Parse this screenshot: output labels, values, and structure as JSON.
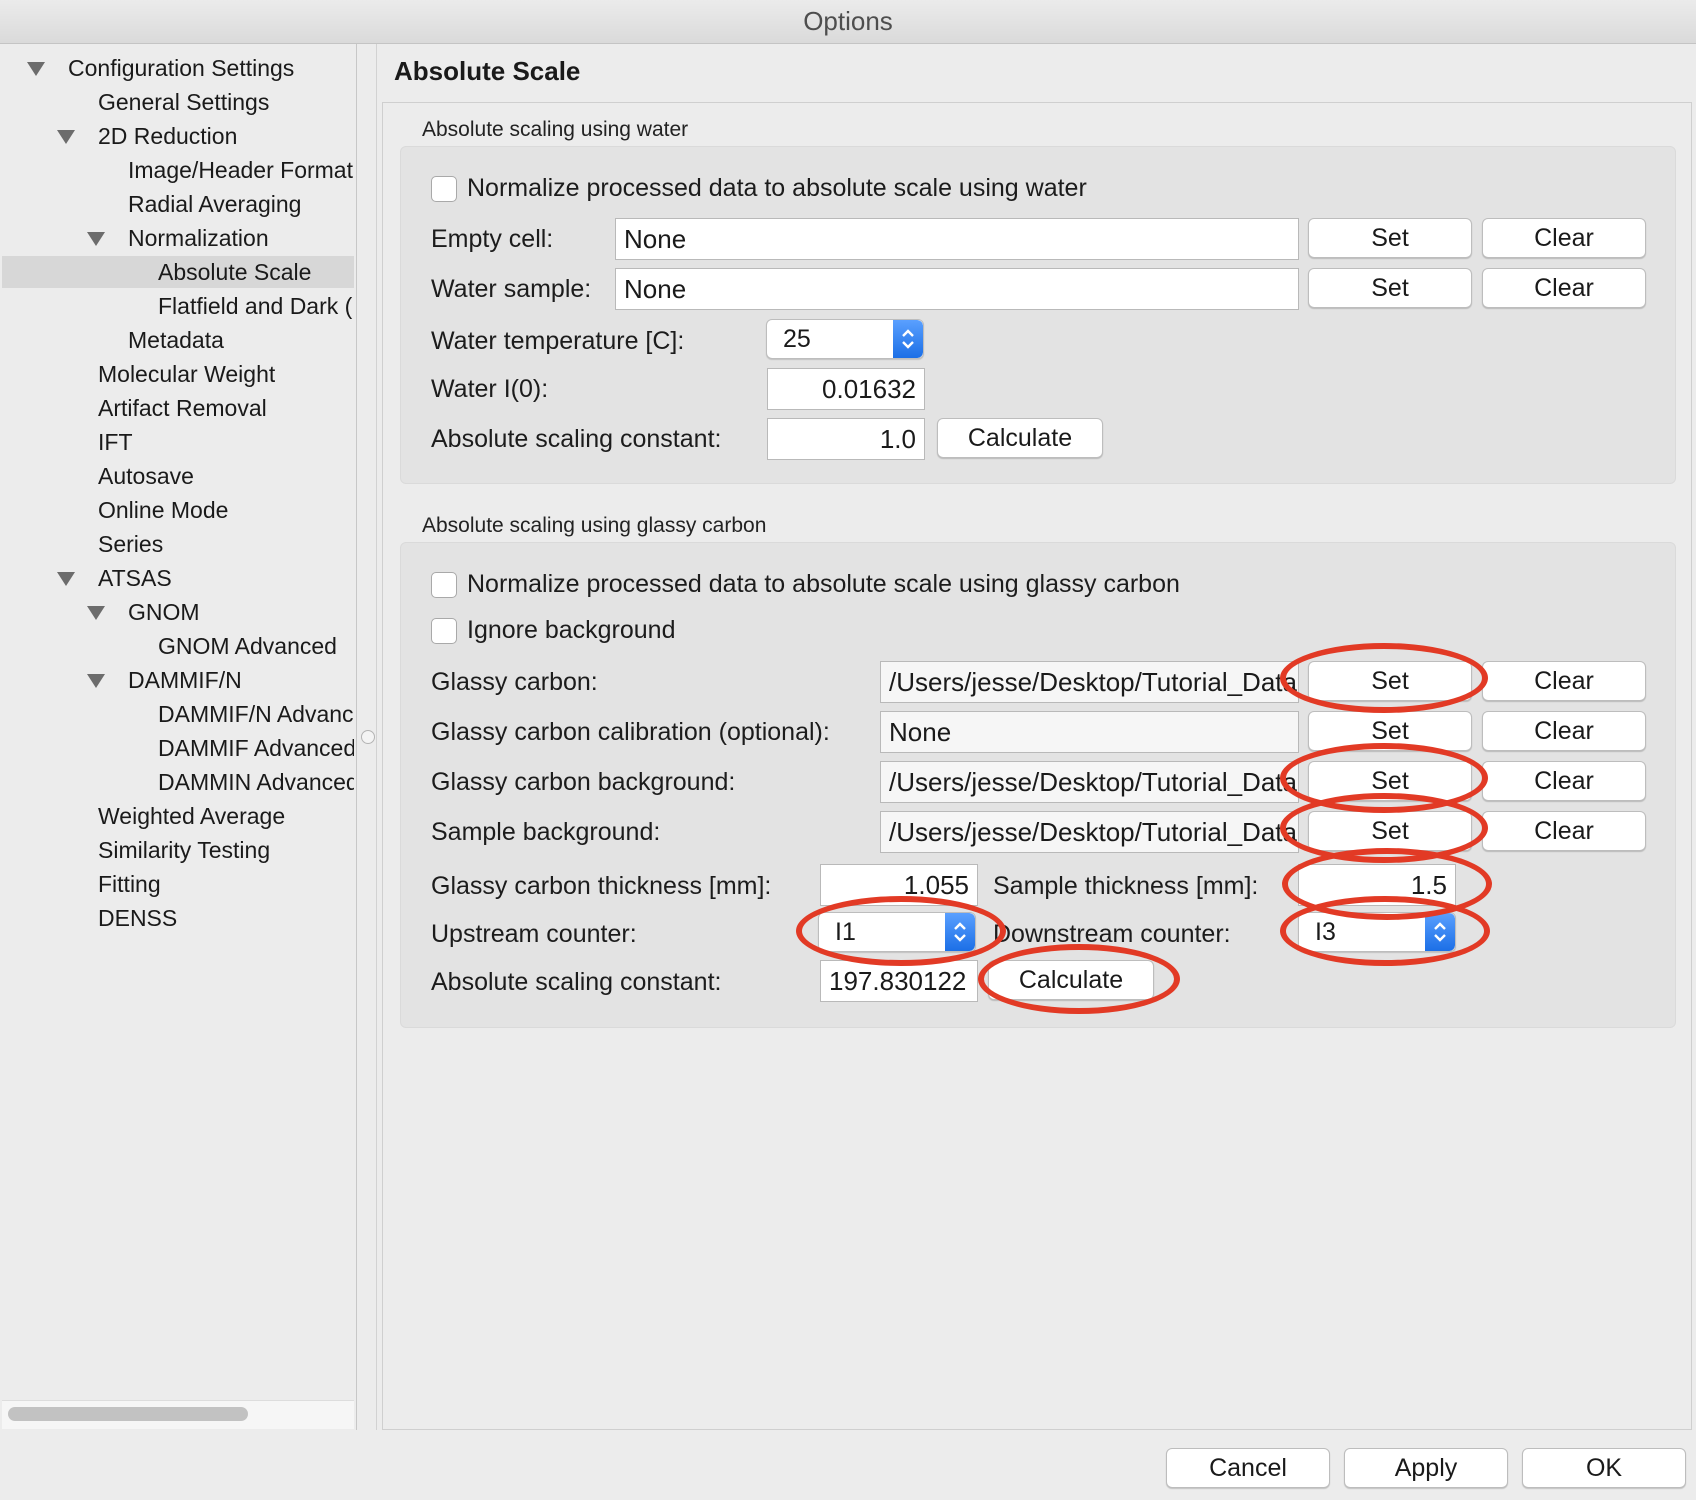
{
  "window": {
    "title": "Options"
  },
  "sidebar": {
    "items": [
      {
        "label": "Configuration Settings",
        "expanded": true
      },
      {
        "label": "General Settings"
      },
      {
        "label": "2D Reduction",
        "expanded": true
      },
      {
        "label": "Image/Header Format"
      },
      {
        "label": "Radial Averaging"
      },
      {
        "label": "Normalization",
        "expanded": true
      },
      {
        "label": "Absolute Scale",
        "selected": true
      },
      {
        "label": "Flatfield and Dark ("
      },
      {
        "label": "Metadata"
      },
      {
        "label": "Molecular Weight"
      },
      {
        "label": "Artifact Removal"
      },
      {
        "label": "IFT"
      },
      {
        "label": "Autosave"
      },
      {
        "label": "Online Mode"
      },
      {
        "label": "Series"
      },
      {
        "label": "ATSAS",
        "expanded": true
      },
      {
        "label": "GNOM",
        "expanded": true
      },
      {
        "label": "GNOM Advanced"
      },
      {
        "label": "DAMMIF/N",
        "expanded": true
      },
      {
        "label": "DAMMIF/N Advance"
      },
      {
        "label": "DAMMIF Advanced"
      },
      {
        "label": "DAMMIN Advanced"
      },
      {
        "label": "Weighted Average"
      },
      {
        "label": "Similarity Testing"
      },
      {
        "label": "Fitting"
      },
      {
        "label": "DENSS"
      }
    ]
  },
  "page": {
    "title": "Absolute Scale"
  },
  "water": {
    "group_title": "Absolute scaling using water",
    "normalize_label": "Normalize processed data to absolute scale using water",
    "normalize_checked": false,
    "empty_cell_label": "Empty cell:",
    "empty_cell_value": "None",
    "water_sample_label": "Water sample:",
    "water_sample_value": "None",
    "temperature_label": "Water temperature [C]:",
    "temperature_value": "25",
    "i0_label": "Water I(0):",
    "i0_value": "0.01632",
    "constant_label": "Absolute scaling constant:",
    "constant_value": "1.0",
    "calculate_label": "Calculate"
  },
  "glassy": {
    "group_title": "Absolute scaling using glassy carbon",
    "normalize_label": "Normalize processed data to absolute scale using glassy carbon",
    "normalize_checked": false,
    "ignore_bg_label": "Ignore background",
    "ignore_bg_checked": false,
    "carbon_label": "Glassy carbon:",
    "carbon_value": "/Users/jesse/Desktop/Tutorial_Data",
    "calibration_label": "Glassy carbon calibration (optional):",
    "calibration_value": "None",
    "carbon_bg_label": "Glassy carbon background:",
    "carbon_bg_value": "/Users/jesse/Desktop/Tutorial_Data",
    "sample_bg_label": "Sample background:",
    "sample_bg_value": "/Users/jesse/Desktop/Tutorial_Data",
    "carbon_thickness_label": "Glassy carbon thickness [mm]:",
    "carbon_thickness_value": "1.055",
    "sample_thickness_label": "Sample thickness [mm]:",
    "sample_thickness_value": "1.5",
    "upstream_label": "Upstream counter:",
    "upstream_value": "I1",
    "downstream_label": "Downstream counter:",
    "downstream_value": "I3",
    "constant_label": "Absolute scaling constant:",
    "constant_value": "197.830122",
    "calculate_label": "Calculate"
  },
  "buttons": {
    "set": "Set",
    "clear": "Clear"
  },
  "footer": {
    "cancel": "Cancel",
    "apply": "Apply",
    "ok": "OK"
  },
  "colors": {
    "annotation_ring": "#e23a25",
    "stepper_blue": "#1c6fe6",
    "selected_row": "#d7d7d7"
  },
  "icons": {
    "tree_expanded": "triangle-down-icon",
    "stepper": "up-down-chevron-icon"
  }
}
